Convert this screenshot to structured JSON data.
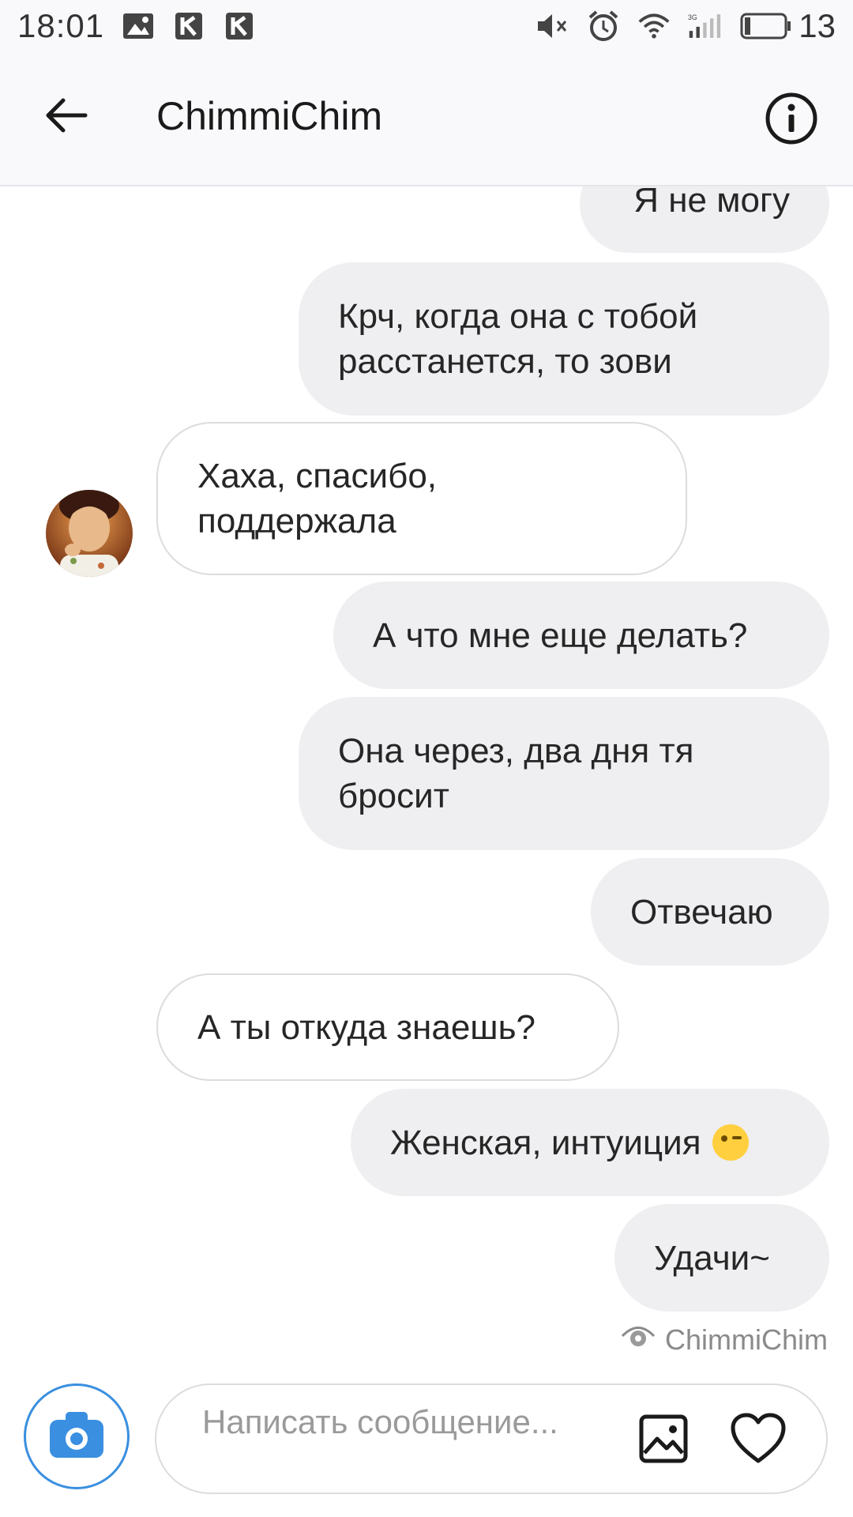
{
  "status_bar": {
    "time": "18:01",
    "battery": "13",
    "icons_left": [
      "gallery-notification-icon",
      "k-app-icon",
      "k-app-icon"
    ],
    "icons_right": [
      "mute-icon",
      "alarm-icon",
      "wifi-icon",
      "signal-3g-icon",
      "battery-icon"
    ]
  },
  "header": {
    "title": "ChimmiChim",
    "back_icon": "arrow-left-icon",
    "info_icon": "info-icon"
  },
  "messages": [
    {
      "side": "out",
      "text": "Я не могу"
    },
    {
      "side": "out",
      "text": "Крч, когда она с тобой расстанется, то зови"
    },
    {
      "side": "in",
      "text": "Хаха, спасибо, поддержала"
    },
    {
      "side": "out",
      "text": "А что мне еще делать?"
    },
    {
      "side": "out",
      "text": "Она через, два дня тя бросит"
    },
    {
      "side": "out",
      "text": "Отвечаю"
    },
    {
      "side": "in",
      "text": "А ты откуда знаешь?"
    },
    {
      "side": "out",
      "text": "Женская, интуиция"
    },
    {
      "side": "out",
      "text": "Удачи~"
    }
  ],
  "seen_by": "ChimmiChim",
  "composer": {
    "placeholder": "Написать сообщение...",
    "camera_icon": "camera-icon",
    "gallery_icon": "image-icon",
    "like_icon": "heart-icon"
  },
  "colors": {
    "outgoing_bubble": "#efeff1",
    "incoming_border": "#dcdcde",
    "camera_accent": "#3a8fe0"
  }
}
